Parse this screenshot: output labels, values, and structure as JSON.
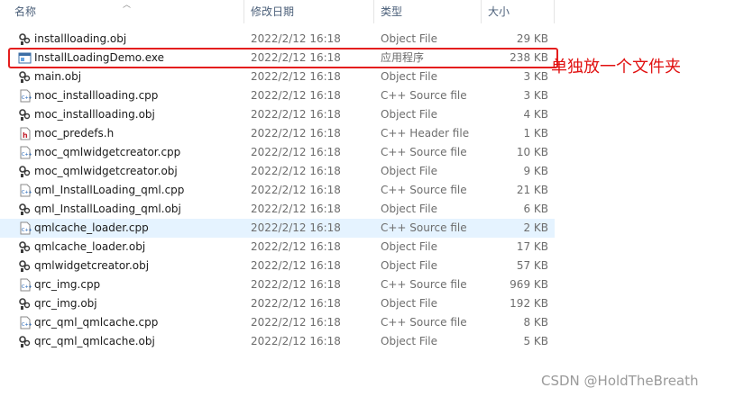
{
  "columns": {
    "name": "名称",
    "date": "修改日期",
    "type": "类型",
    "size": "大小"
  },
  "files": [
    {
      "name": "installloading.obj",
      "date": "2022/2/12 16:18",
      "type": "Object File",
      "size": "29 KB",
      "icon": "obj-file-icon"
    },
    {
      "name": "InstallLoadingDemo.exe",
      "date": "2022/2/12 16:18",
      "type": "应用程序",
      "size": "238 KB",
      "icon": "exe-file-icon"
    },
    {
      "name": "main.obj",
      "date": "2022/2/12 16:18",
      "type": "Object File",
      "size": "3 KB",
      "icon": "obj-file-icon"
    },
    {
      "name": "moc_installloading.cpp",
      "date": "2022/2/12 16:18",
      "type": "C++ Source file",
      "size": "3 KB",
      "icon": "cpp-file-icon"
    },
    {
      "name": "moc_installloading.obj",
      "date": "2022/2/12 16:18",
      "type": "Object File",
      "size": "4 KB",
      "icon": "obj-file-icon"
    },
    {
      "name": "moc_predefs.h",
      "date": "2022/2/12 16:18",
      "type": "C++ Header file",
      "size": "1 KB",
      "icon": "header-file-icon"
    },
    {
      "name": "moc_qmlwidgetcreator.cpp",
      "date": "2022/2/12 16:18",
      "type": "C++ Source file",
      "size": "10 KB",
      "icon": "cpp-file-icon"
    },
    {
      "name": "moc_qmlwidgetcreator.obj",
      "date": "2022/2/12 16:18",
      "type": "Object File",
      "size": "9 KB",
      "icon": "obj-file-icon"
    },
    {
      "name": "qml_InstallLoading_qml.cpp",
      "date": "2022/2/12 16:18",
      "type": "C++ Source file",
      "size": "21 KB",
      "icon": "cpp-file-icon"
    },
    {
      "name": "qml_InstallLoading_qml.obj",
      "date": "2022/2/12 16:18",
      "type": "Object File",
      "size": "6 KB",
      "icon": "obj-file-icon"
    },
    {
      "name": "qmlcache_loader.cpp",
      "date": "2022/2/12 16:18",
      "type": "C++ Source file",
      "size": "2 KB",
      "icon": "cpp-file-icon"
    },
    {
      "name": "qmlcache_loader.obj",
      "date": "2022/2/12 16:18",
      "type": "Object File",
      "size": "17 KB",
      "icon": "obj-file-icon"
    },
    {
      "name": "qmlwidgetcreator.obj",
      "date": "2022/2/12 16:18",
      "type": "Object File",
      "size": "57 KB",
      "icon": "obj-file-icon"
    },
    {
      "name": "qrc_img.cpp",
      "date": "2022/2/12 16:18",
      "type": "C++ Source file",
      "size": "969 KB",
      "icon": "cpp-file-icon"
    },
    {
      "name": "qrc_img.obj",
      "date": "2022/2/12 16:18",
      "type": "Object File",
      "size": "192 KB",
      "icon": "obj-file-icon"
    },
    {
      "name": "qrc_qml_qmlcache.cpp",
      "date": "2022/2/12 16:18",
      "type": "C++ Source file",
      "size": "8 KB",
      "icon": "cpp-file-icon"
    },
    {
      "name": "qrc_qml_qmlcache.obj",
      "date": "2022/2/12 16:18",
      "type": "Object File",
      "size": "5 KB",
      "icon": "obj-file-icon"
    }
  ],
  "annotation": {
    "text": "单独放一个文件夹",
    "color": "#e11111"
  },
  "watermark": "CSDN @HoldTheBreath",
  "colors": {
    "hover_row": "#e5f3ff",
    "highlight_border": "#e41e1e"
  }
}
